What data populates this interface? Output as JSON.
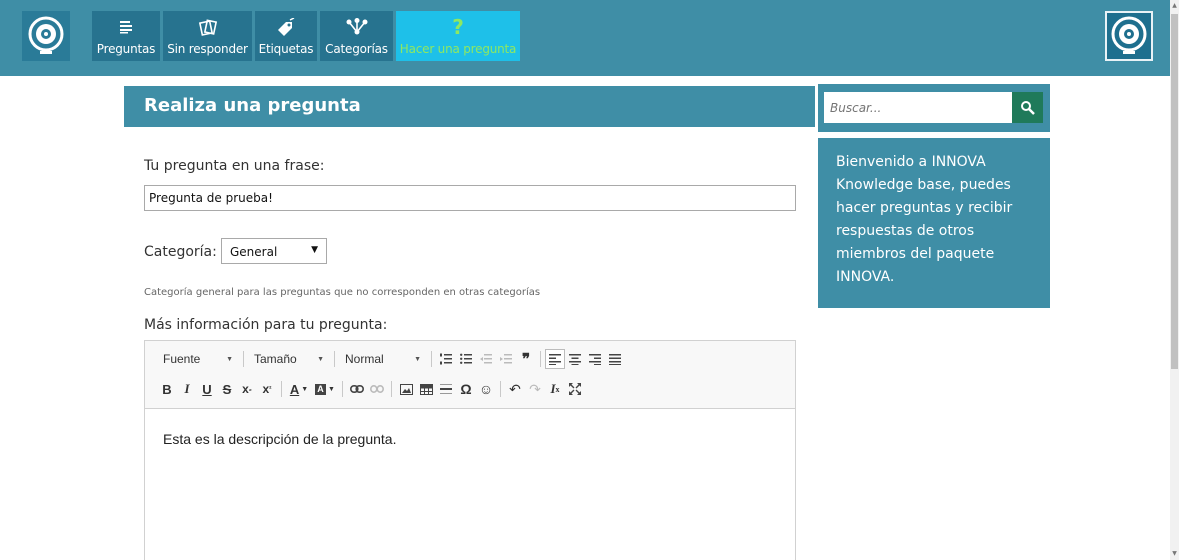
{
  "nav": {
    "items": [
      {
        "label": "Preguntas",
        "icon": "list-icon"
      },
      {
        "label": "Sin responder",
        "icon": "cards-icon"
      },
      {
        "label": "Etiquetas",
        "icon": "tag-icon"
      },
      {
        "label": "Categorías",
        "icon": "sitemap-icon"
      },
      {
        "label": "Hacer una pregunta",
        "icon": "question-icon"
      }
    ]
  },
  "form": {
    "title": "Realiza una pregunta",
    "question_label": "Tu pregunta en una frase:",
    "question_value": "Pregunta de prueba!",
    "category_label": "Categoría:",
    "category_value": "General",
    "category_hint": "Categoría general para las preguntas que no corresponden en otras categorías",
    "more_info_label": "Más información para tu pregunta:"
  },
  "editor": {
    "font_label": "Fuente",
    "size_label": "Tamaño",
    "format_label": "Normal",
    "content": "Esta es la descripción de la pregunta."
  },
  "sidebar": {
    "search_placeholder": "Buscar...",
    "welcome": "Bienvenido a INNOVA Knowledge base, puedes hacer preguntas y recibir respuestas de otros miembros del paquete INNOVA."
  },
  "colors": {
    "primary": "#3f8ea6",
    "nav_dark": "#27738f",
    "nav_active": "#1ec0e9",
    "search_button": "#1f7a5a"
  }
}
